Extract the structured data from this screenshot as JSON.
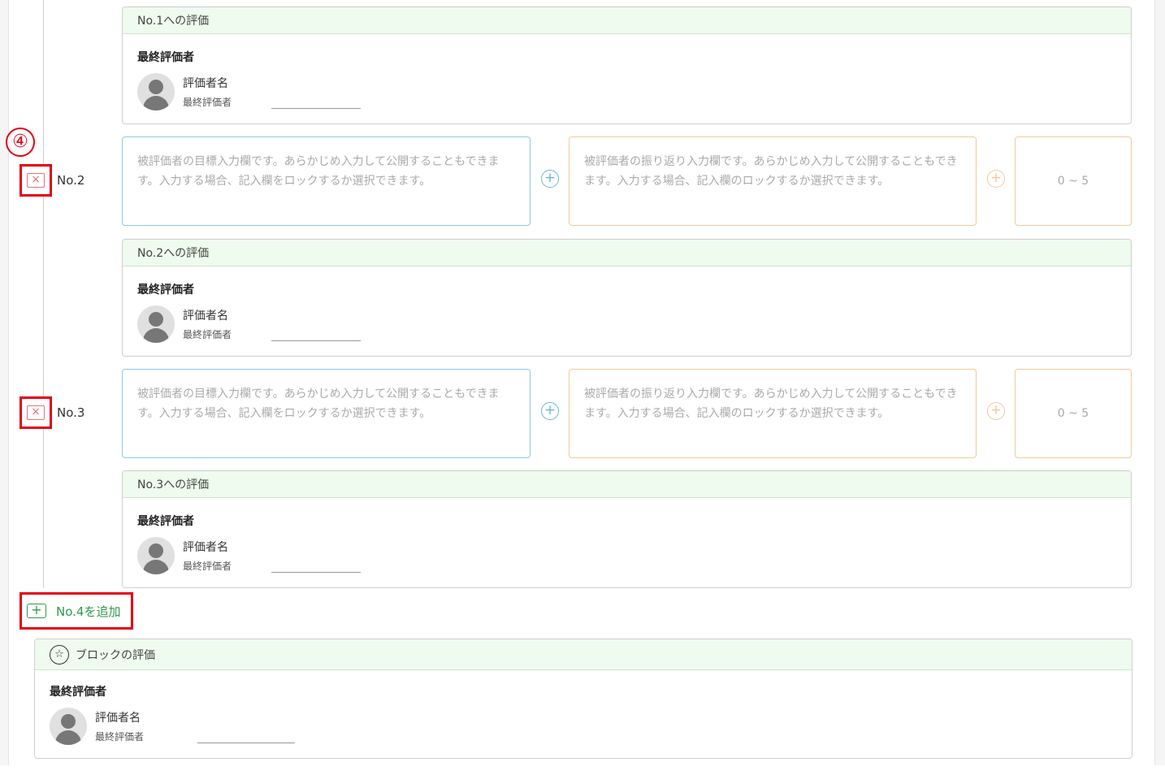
{
  "annotation": {
    "marker": "④"
  },
  "common": {
    "role_label": "最終評価者",
    "evaluator_name": "評価者名",
    "evaluator_role": "最終評価者",
    "goal_placeholder": "被評価者の目標入力欄です。あらかじめ入力して公開することもできます。入力する場合、記入欄をロックするか選択できます。",
    "reflection_placeholder": "被評価者の振り返り入力欄です。あらかじめ入力して公開することもできます。入力する場合、記入欄のロックするか選択できます。",
    "score_placeholder": "0 ~ 5",
    "plus": "+",
    "delete_glyph": "×"
  },
  "evaluations": [
    {
      "title": "No.1への評価"
    },
    {
      "title": "No.2への評価"
    },
    {
      "title": "No.3への評価"
    }
  ],
  "rows": [
    {
      "label": "No.2"
    },
    {
      "label": "No.3"
    }
  ],
  "add_button": {
    "label": "No.4を追加",
    "icon": "+"
  },
  "block_evaluation": {
    "title": "ブロックの評価",
    "icon": "star-badge-icon",
    "icon_glyph": "☆"
  },
  "colors": {
    "accent_green": "#2e9a4a",
    "header_green_bg": "#eefbee",
    "goal_border": "#8fc6ec",
    "reflection_border": "#f3c99a",
    "annotation_red": "#e60012"
  }
}
